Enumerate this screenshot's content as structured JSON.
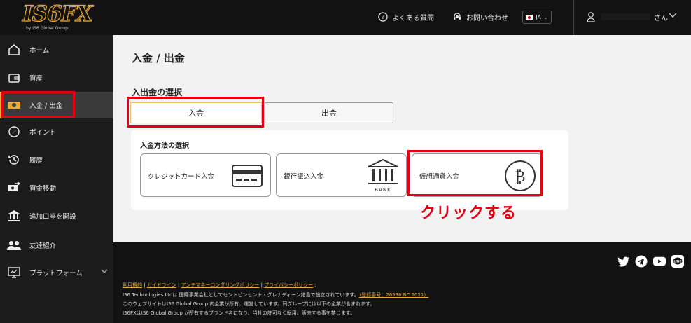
{
  "header": {
    "logo_text": "IS6FX",
    "logo_sub": "by IS6 Global Group",
    "faq_label": "よくある質問",
    "contact_label": "お問い合わせ",
    "language": "JA",
    "user_suffix": "さん"
  },
  "sidebar": {
    "items": [
      {
        "label": "ホーム",
        "icon": "home-icon"
      },
      {
        "label": "資産",
        "icon": "wallet-icon"
      },
      {
        "label": "入金 / 出金",
        "icon": "money-icon"
      },
      {
        "label": "ポイント",
        "icon": "point-icon"
      },
      {
        "label": "履歴",
        "icon": "history-icon"
      },
      {
        "label": "資金移動",
        "icon": "transfer-icon"
      },
      {
        "label": "追加口座を開設",
        "icon": "bank-icon"
      },
      {
        "label": "友達紹介",
        "icon": "friends-icon"
      },
      {
        "label": "プラットフォーム",
        "icon": "monitor-icon"
      }
    ],
    "active_index": 2
  },
  "main": {
    "page_title": "入金 / 出金",
    "section_title": "入出金の選択",
    "tabs": {
      "deposit": "入金",
      "withdraw": "出金"
    },
    "methods_title": "入金方法の選択",
    "methods": [
      {
        "label": "クレジットカード入金",
        "icon": "credit-card-icon"
      },
      {
        "label": "銀行振込入金",
        "icon": "bank-building-icon",
        "icon_text": "BANK"
      },
      {
        "label": "仮想通貨入金",
        "icon": "bitcoin-icon"
      }
    ],
    "annotation": "クリックする"
  },
  "footer": {
    "links": [
      "利用規約",
      "ガイドライン",
      "アンチマネーロンダリングポリシー",
      "プライバシーポリシー"
    ],
    "line1": "IS6 Technologies Ltdは 国際事業会社としてセントビンセント・グレナディーン諸島で設立されています。",
    "registration": "（登録番号：26536 BC 2021）",
    "line2": "このウェブサイトはIS6 Global Group 内企業が所有、運営しています。同グループには以下の企業が含まれます。",
    "line3": "IS6FXはIS6 Global Group が所有するブランド名になり、当社の許可なく転用、販売する事を禁じます。",
    "social": [
      "twitter-icon",
      "telegram-icon",
      "youtube-icon",
      "line-icon"
    ]
  },
  "colors": {
    "accent": "#e8a93b",
    "highlight": "#e60012",
    "dark": "#121212",
    "sidebar": "#1c1c1c"
  }
}
